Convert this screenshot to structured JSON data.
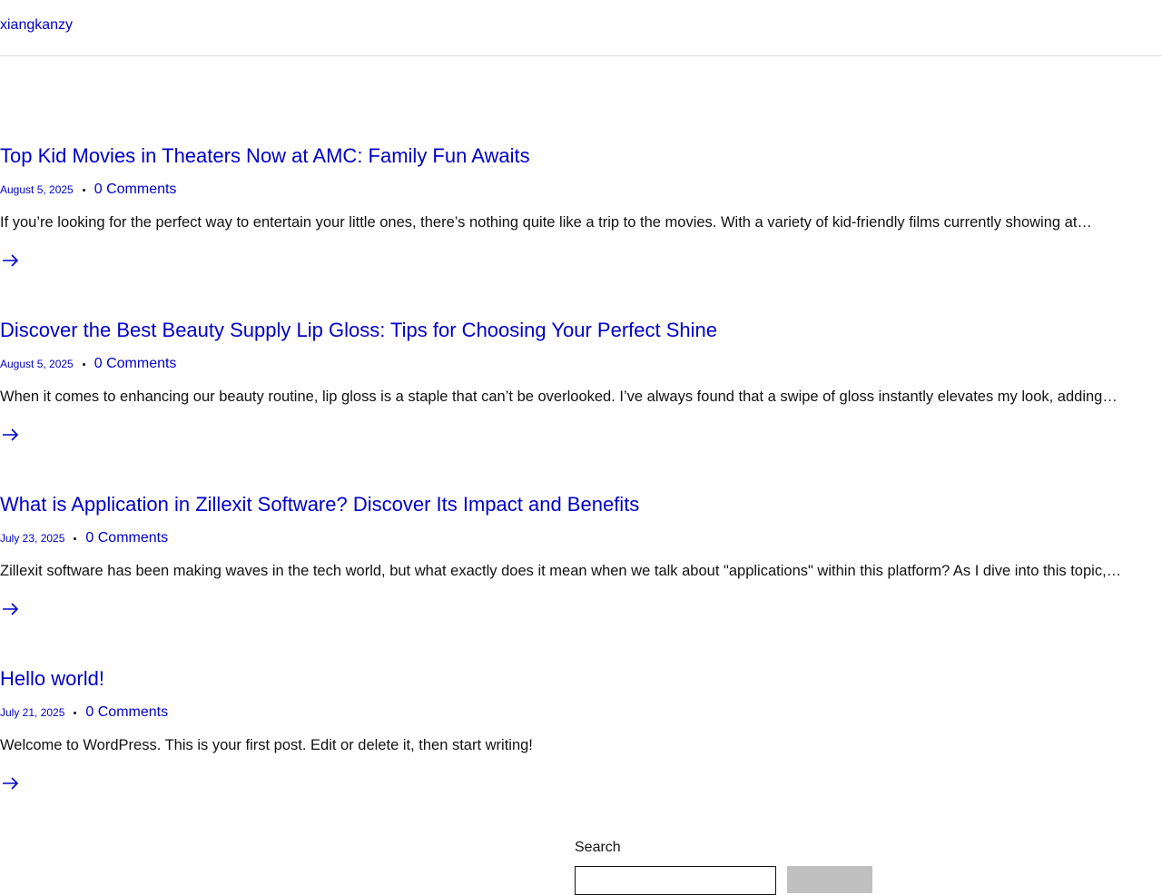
{
  "site": {
    "title": "xiangkanzy"
  },
  "posts": [
    {
      "title": "Top Kid Movies in Theaters Now at AMC: Family Fun Awaits",
      "date": "August 5, 2025",
      "comments": "0 Comments",
      "excerpt": "If you’re looking for the perfect way to entertain your little ones, there’s nothing quite like a trip to the movies. With a variety of kid-friendly films currently showing at…",
      "read_more_icon": "arrow-right-icon"
    },
    {
      "title": "Discover the Best Beauty Supply Lip Gloss: Tips for Choosing Your Perfect Shine",
      "date": "August 5, 2025",
      "comments": "0 Comments",
      "excerpt": "When it comes to enhancing our beauty routine, lip gloss is a staple that can’t be overlooked. I’ve always found that a swipe of gloss instantly elevates my look, adding…",
      "read_more_icon": "arrow-right-icon"
    },
    {
      "title": "What is Application in Zillexit Software? Discover Its Impact and Benefits",
      "date": "July 23, 2025",
      "comments": "0 Comments",
      "excerpt": "Zillexit software has been making waves in the tech world, but what exactly does it mean when we talk about \"applications\" within this platform? As I dive into this topic,…",
      "read_more_icon": "arrow-right-icon"
    },
    {
      "title": "Hello world!",
      "date": "July 21, 2025",
      "comments": "0 Comments",
      "excerpt": "Welcome to WordPress. This is your first post. Edit or delete it, then start writing!",
      "read_more_icon": "arrow-right-icon"
    }
  ],
  "search": {
    "label": "Search",
    "input_value": "",
    "button_label": ""
  },
  "colors": {
    "link": "#0000c8",
    "text": "#111111",
    "button_bg": "#c0c0c0",
    "divider": "#dcdcdc"
  }
}
